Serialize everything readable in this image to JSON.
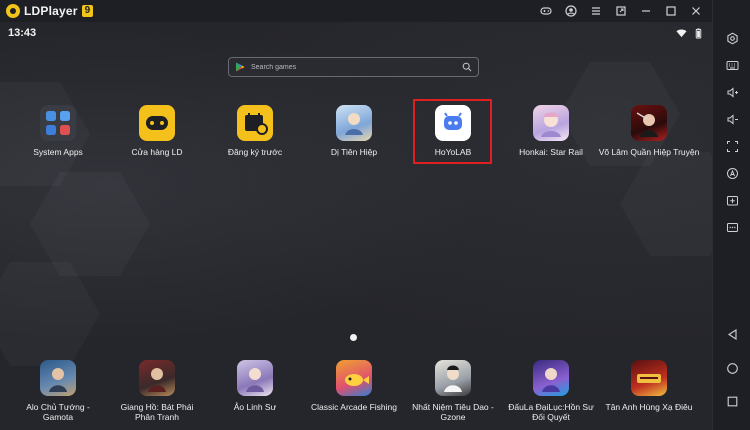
{
  "titlebar": {
    "app_name": "LDPlayer",
    "version": "9",
    "buttons": [
      "gamepad-icon",
      "account-icon",
      "menu-icon",
      "window-mode-icon",
      "minimize-icon",
      "maximize-icon",
      "close-icon",
      "collapse-sidebar-icon"
    ]
  },
  "statusbar": {
    "time": "13:43"
  },
  "search": {
    "placeholder": "Search games"
  },
  "apps_top": [
    {
      "label": "System Apps",
      "icon": "system-apps-icon"
    },
    {
      "label": "Cửa hàng LD",
      "icon": "ld-store-icon"
    },
    {
      "label": "Đăng ký trước",
      "icon": "preregister-icon"
    },
    {
      "label": "Dị Tiên Hiệp",
      "icon": "di-tien-hiep-icon"
    },
    {
      "label": "HoYoLAB",
      "icon": "hoyolab-icon"
    },
    {
      "label": "Honkai: Star Rail",
      "icon": "honkai-star-rail-icon"
    },
    {
      "label": "Võ Lâm Quần Hiệp Truyện",
      "icon": "vo-lam-icon"
    }
  ],
  "apps_dock": [
    {
      "label": "Alo Chủ Tướng - Gamota",
      "icon": "alo-chu-tuong-icon"
    },
    {
      "label": "Giang Hồ: Bát Phái Phân Tranh",
      "icon": "giang-ho-icon"
    },
    {
      "label": "Ảo Linh Sư",
      "icon": "ao-linh-su-icon"
    },
    {
      "label": "Classic Arcade Fishing",
      "icon": "arcade-fishing-icon"
    },
    {
      "label": "Nhất Niệm Tiêu Dao - Gzone",
      "icon": "nhat-niem-icon"
    },
    {
      "label": "ĐấuLa ĐạiLục:Hồn Sư Đối Quyết",
      "icon": "dau-la-icon"
    },
    {
      "label": "Tân Anh Hùng Xạ Điêu",
      "icon": "tan-anh-hung-icon"
    }
  ],
  "sidebar": [
    "settings-icon",
    "keyboard-icon",
    "volume-up-icon",
    "volume-down-icon",
    "screenshot-icon",
    "auto-icon",
    "add-instance-icon",
    "more-icon",
    "back-icon",
    "home-icon",
    "recents-icon"
  ],
  "colors": {
    "highlight": "#e02020",
    "brand": "#f0c419",
    "hoyolab": "#4a7cf0"
  }
}
